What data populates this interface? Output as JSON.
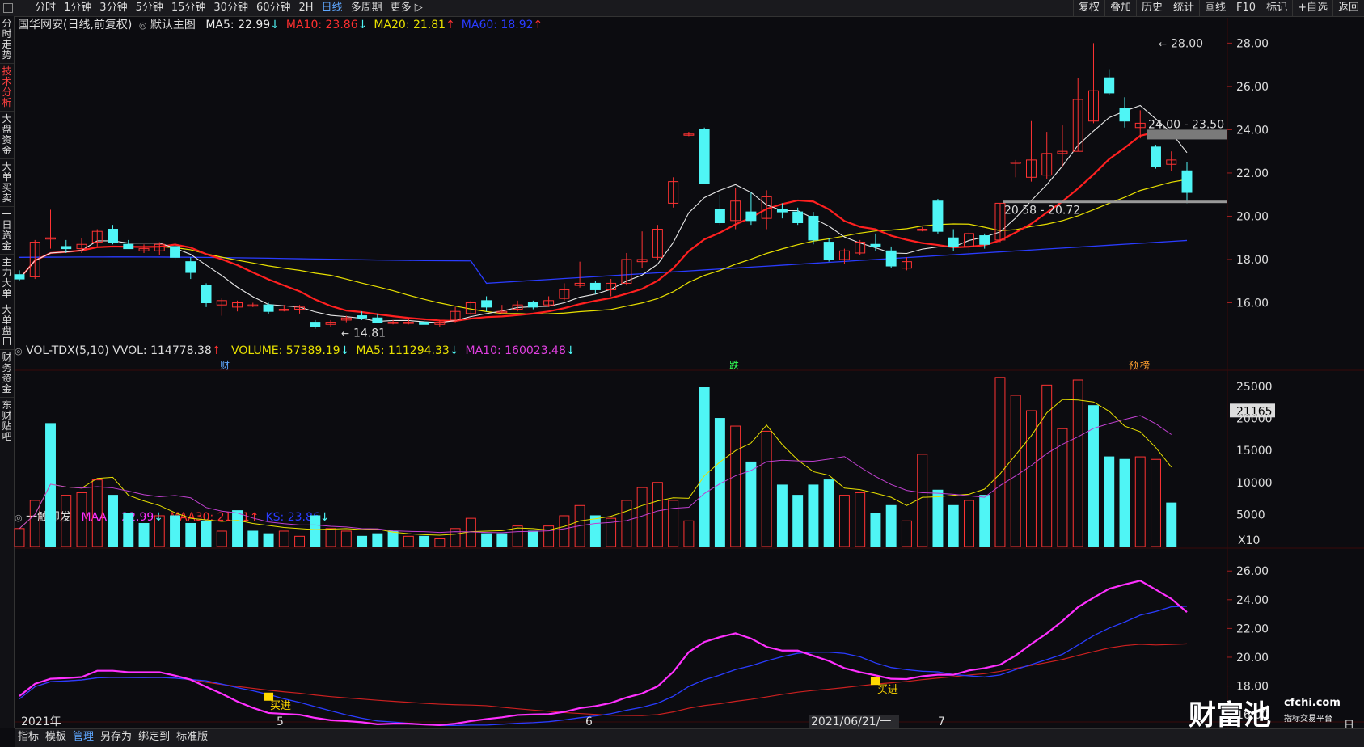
{
  "topbar": {
    "periods": [
      "分时",
      "1分钟",
      "3分钟",
      "5分钟",
      "15分钟",
      "30分钟",
      "60分钟",
      "2H",
      "日线",
      "多周期",
      "更多"
    ],
    "active_period": "日线",
    "right_buttons": [
      "复权",
      "叠加",
      "历史",
      "统计",
      "画线",
      "F10",
      "标记",
      "+自选",
      "返回"
    ]
  },
  "sidebar": {
    "tabs": [
      "分时走势",
      "技术分析",
      "大盘资金",
      "大单买卖",
      "一日资金",
      "主力大单",
      "大单盘口",
      "财务资金",
      "东财贴吧"
    ],
    "active": "技术分析"
  },
  "main_panel": {
    "stock": "国华网安(日线,前复权)",
    "template": "默认主图",
    "indicators": [
      {
        "text": "MA5: 22.99",
        "arrow": "↓",
        "color": "#e8e8e8"
      },
      {
        "text": "MA10: 23.86",
        "arrow": "↓",
        "color": "#ff3030"
      },
      {
        "text": "MA20: 21.81",
        "arrow": "↑",
        "color": "#e8e000"
      },
      {
        "text": "MA60: 18.92",
        "arrow": "↑",
        "color": "#2a3cff"
      }
    ],
    "y_ticks": [
      "28.00",
      "26.00",
      "24.00",
      "22.00",
      "20.00",
      "18.00",
      "16.00"
    ],
    "annotations": {
      "high": "28.00",
      "low": "14.81",
      "zone_top": "24.00 - 23.50",
      "zone_bottom": "20.58 - 20.72"
    },
    "markers": [
      "财",
      "跌",
      "预",
      "榜"
    ]
  },
  "volume_panel": {
    "title": "VOL-TDX(5,10) VVOL: 114778.38",
    "title_arrow": "↑",
    "indicators": [
      {
        "text": "VOLUME: 57389.19",
        "arrow": "↓",
        "color": "#e8e000"
      },
      {
        "text": "MA5: 111294.33",
        "arrow": "↓",
        "color": "#e8e000"
      },
      {
        "text": "MA10: 160023.48",
        "arrow": "↓",
        "color": "#e040e0"
      }
    ],
    "y_ticks": [
      "25000",
      "21165",
      "20000",
      "15000",
      "10000",
      "5000"
    ],
    "unit": "X10"
  },
  "signal_panel": {
    "title": "一触即发",
    "indicators": [
      {
        "text": "MAA5: 22.99",
        "arrow": "↓",
        "color": "#ff30ff"
      },
      {
        "text": "MAA30: 21.01",
        "arrow": "↑",
        "color": "#ff3030"
      },
      {
        "text": "KS: 23.86",
        "arrow": "↓",
        "color": "#2a3cff"
      }
    ],
    "y_ticks": [
      "26.00",
      "24.00",
      "22.00",
      "20.00",
      "18.00",
      "16.00"
    ],
    "buy_label": "买进"
  },
  "x_axis": {
    "labels": [
      "2021年",
      "5",
      "6",
      "2021/06/21/一",
      "7"
    ],
    "period_label": "日线"
  },
  "watermark": {
    "brand": "财富池",
    "site": "cfchi.com",
    "tagline": "指标交易平台"
  },
  "bottom_tabs": [
    "指标",
    "模板",
    "管理",
    "另存为",
    "绑定到",
    "标准版"
  ],
  "bottom_active": "管理",
  "colors": {
    "up": "#ff3333",
    "down": "#4ff5f5",
    "bg": "#0c0c10",
    "ma5": "#e8e8e8",
    "ma10": "#ff2020",
    "ma20": "#e8e000",
    "ma60": "#2a3cff"
  },
  "chart_data": {
    "type": "candlestick",
    "candles": [
      {
        "o": 17.3,
        "h": 17.5,
        "l": 17.0,
        "c": 17.1
      },
      {
        "o": 17.2,
        "h": 18.9,
        "l": 17.1,
        "c": 18.8
      },
      {
        "o": 19.0,
        "h": 20.3,
        "l": 18.5,
        "c": 19.0
      },
      {
        "o": 18.6,
        "h": 18.9,
        "l": 18.3,
        "c": 18.5
      },
      {
        "o": 18.5,
        "h": 19.0,
        "l": 18.3,
        "c": 18.7
      },
      {
        "o": 18.8,
        "h": 19.4,
        "l": 18.6,
        "c": 19.3
      },
      {
        "o": 19.4,
        "h": 19.6,
        "l": 18.7,
        "c": 18.8
      },
      {
        "o": 18.7,
        "h": 18.9,
        "l": 18.5,
        "c": 18.5
      },
      {
        "o": 18.4,
        "h": 18.7,
        "l": 18.3,
        "c": 18.5
      },
      {
        "o": 18.4,
        "h": 18.8,
        "l": 18.2,
        "c": 18.7
      },
      {
        "o": 18.6,
        "h": 18.8,
        "l": 18.0,
        "c": 18.1
      },
      {
        "o": 17.9,
        "h": 18.1,
        "l": 17.1,
        "c": 17.4
      },
      {
        "o": 16.8,
        "h": 16.9,
        "l": 15.8,
        "c": 16.0
      },
      {
        "o": 15.9,
        "h": 16.2,
        "l": 15.4,
        "c": 16.1
      },
      {
        "o": 15.8,
        "h": 16.1,
        "l": 15.6,
        "c": 16.0
      },
      {
        "o": 15.9,
        "h": 16.0,
        "l": 15.8,
        "c": 15.9
      },
      {
        "o": 15.9,
        "h": 16.0,
        "l": 15.5,
        "c": 15.6
      },
      {
        "o": 15.7,
        "h": 15.9,
        "l": 15.6,
        "c": 15.7
      },
      {
        "o": 15.7,
        "h": 15.9,
        "l": 15.5,
        "c": 15.8
      },
      {
        "o": 15.1,
        "h": 15.2,
        "l": 14.8,
        "c": 14.9
      },
      {
        "o": 15.0,
        "h": 15.2,
        "l": 14.9,
        "c": 15.1
      },
      {
        "o": 15.2,
        "h": 15.4,
        "l": 15.1,
        "c": 15.3
      },
      {
        "o": 15.4,
        "h": 15.6,
        "l": 15.2,
        "c": 15.3
      },
      {
        "o": 15.3,
        "h": 15.5,
        "l": 15.1,
        "c": 15.1
      },
      {
        "o": 15.1,
        "h": 15.2,
        "l": 15.0,
        "c": 15.1
      },
      {
        "o": 15.1,
        "h": 15.3,
        "l": 15.0,
        "c": 15.1
      },
      {
        "o": 15.1,
        "h": 15.2,
        "l": 15.0,
        "c": 15.0
      },
      {
        "o": 15.0,
        "h": 15.2,
        "l": 14.9,
        "c": 15.1
      },
      {
        "o": 15.2,
        "h": 15.8,
        "l": 15.1,
        "c": 15.6
      },
      {
        "o": 15.5,
        "h": 16.1,
        "l": 15.4,
        "c": 16.0
      },
      {
        "o": 16.1,
        "h": 16.3,
        "l": 15.6,
        "c": 15.8
      },
      {
        "o": 15.6,
        "h": 15.9,
        "l": 15.5,
        "c": 15.6
      },
      {
        "o": 15.7,
        "h": 16.1,
        "l": 15.6,
        "c": 15.9
      },
      {
        "o": 16.0,
        "h": 16.1,
        "l": 15.7,
        "c": 15.8
      },
      {
        "o": 15.9,
        "h": 16.3,
        "l": 15.8,
        "c": 16.1
      },
      {
        "o": 16.2,
        "h": 16.9,
        "l": 16.1,
        "c": 16.6
      },
      {
        "o": 16.8,
        "h": 17.9,
        "l": 16.7,
        "c": 16.9
      },
      {
        "o": 16.9,
        "h": 17.0,
        "l": 16.4,
        "c": 16.6
      },
      {
        "o": 16.6,
        "h": 17.1,
        "l": 16.3,
        "c": 16.9
      },
      {
        "o": 16.9,
        "h": 18.3,
        "l": 16.8,
        "c": 18.0
      },
      {
        "o": 17.9,
        "h": 19.3,
        "l": 17.6,
        "c": 18.0
      },
      {
        "o": 18.1,
        "h": 19.6,
        "l": 18.0,
        "c": 19.4
      },
      {
        "o": 20.6,
        "h": 21.8,
        "l": 20.4,
        "c": 21.6
      },
      {
        "o": 23.8,
        "h": 23.9,
        "l": 23.7,
        "c": 23.8
      },
      {
        "o": 24.0,
        "h": 24.1,
        "l": 21.5,
        "c": 21.5
      },
      {
        "o": 20.3,
        "h": 21.0,
        "l": 19.6,
        "c": 19.7
      },
      {
        "o": 19.8,
        "h": 21.3,
        "l": 19.4,
        "c": 20.7
      },
      {
        "o": 20.2,
        "h": 21.1,
        "l": 19.6,
        "c": 19.8
      },
      {
        "o": 19.9,
        "h": 21.2,
        "l": 19.4,
        "c": 20.9
      },
      {
        "o": 20.3,
        "h": 20.6,
        "l": 19.9,
        "c": 20.2
      },
      {
        "o": 20.2,
        "h": 20.4,
        "l": 19.6,
        "c": 19.7
      },
      {
        "o": 20.0,
        "h": 20.2,
        "l": 18.7,
        "c": 18.9
      },
      {
        "o": 18.8,
        "h": 19.0,
        "l": 17.9,
        "c": 18.0
      },
      {
        "o": 18.0,
        "h": 18.5,
        "l": 17.8,
        "c": 18.4
      },
      {
        "o": 18.3,
        "h": 18.9,
        "l": 18.2,
        "c": 18.8
      },
      {
        "o": 18.7,
        "h": 19.2,
        "l": 18.4,
        "c": 18.6
      },
      {
        "o": 18.4,
        "h": 18.6,
        "l": 17.6,
        "c": 17.7
      },
      {
        "o": 17.6,
        "h": 18.1,
        "l": 17.5,
        "c": 17.9
      },
      {
        "o": 19.4,
        "h": 19.5,
        "l": 19.3,
        "c": 19.4
      },
      {
        "o": 20.7,
        "h": 20.8,
        "l": 19.2,
        "c": 19.3
      },
      {
        "o": 19.0,
        "h": 19.4,
        "l": 18.4,
        "c": 18.6
      },
      {
        "o": 18.6,
        "h": 19.4,
        "l": 18.3,
        "c": 19.2
      },
      {
        "o": 19.1,
        "h": 19.2,
        "l": 18.5,
        "c": 18.7
      },
      {
        "o": 18.9,
        "h": 20.6,
        "l": 18.8,
        "c": 20.6
      },
      {
        "o": 22.5,
        "h": 22.6,
        "l": 21.8,
        "c": 22.5
      },
      {
        "o": 21.8,
        "h": 24.4,
        "l": 21.6,
        "c": 22.6
      },
      {
        "o": 21.9,
        "h": 23.9,
        "l": 21.7,
        "c": 22.9
      },
      {
        "o": 22.9,
        "h": 24.2,
        "l": 22.3,
        "c": 23.0
      },
      {
        "o": 23.0,
        "h": 26.4,
        "l": 23.0,
        "c": 25.4
      },
      {
        "o": 24.4,
        "h": 28.0,
        "l": 24.3,
        "c": 25.8
      },
      {
        "o": 26.4,
        "h": 26.8,
        "l": 25.6,
        "c": 25.7
      },
      {
        "o": 25.0,
        "h": 25.5,
        "l": 24.1,
        "c": 24.4
      },
      {
        "o": 24.1,
        "h": 24.9,
        "l": 23.6,
        "c": 24.3
      },
      {
        "o": 23.2,
        "h": 23.3,
        "l": 22.2,
        "c": 22.3
      },
      {
        "o": 22.4,
        "h": 23.0,
        "l": 22.1,
        "c": 22.6
      },
      {
        "o": 22.1,
        "h": 22.5,
        "l": 20.6,
        "c": 21.1
      }
    ],
    "volume": [
      7,
      18,
      48,
      20,
      21,
      26,
      20,
      13,
      9,
      12,
      12,
      9,
      10,
      6,
      14,
      6,
      5,
      6,
      4,
      12,
      7,
      6,
      4,
      5,
      6,
      4,
      4,
      3,
      7,
      11,
      5,
      5,
      8,
      6,
      8,
      12,
      16,
      12,
      11,
      18,
      23,
      25,
      18,
      10,
      62,
      50,
      47,
      33,
      45,
      24,
      20,
      24,
      26,
      20,
      21,
      13,
      16,
      10,
      36,
      22,
      16,
      18,
      20,
      66,
      59,
      53,
      63,
      46,
      65,
      55,
      35,
      34,
      35,
      34,
      17
    ],
    "volume_colors_up": [
      true,
      true,
      false,
      true,
      true,
      true,
      false,
      false,
      false,
      true,
      false,
      false,
      false,
      true,
      false,
      false,
      false,
      true,
      true,
      false,
      true,
      true,
      false,
      false,
      false,
      true,
      false,
      true,
      true,
      true,
      false,
      false,
      true,
      false,
      true,
      true,
      true,
      false,
      true,
      true,
      true,
      true,
      true,
      true,
      false,
      false,
      true,
      false,
      true,
      false,
      false,
      false,
      false,
      true,
      true,
      false,
      false,
      true,
      true,
      false,
      false,
      true,
      false,
      true,
      true,
      true,
      true,
      true,
      true,
      false,
      false,
      false,
      true,
      true,
      false
    ],
    "x_labels": [
      "2021年",
      "5",
      "6",
      "7"
    ],
    "y_range_price": [
      14.3,
      28.5
    ],
    "y_range_volume": [
      0,
      26000
    ],
    "y_range_signal": [
      15.5,
      26.8
    ]
  }
}
